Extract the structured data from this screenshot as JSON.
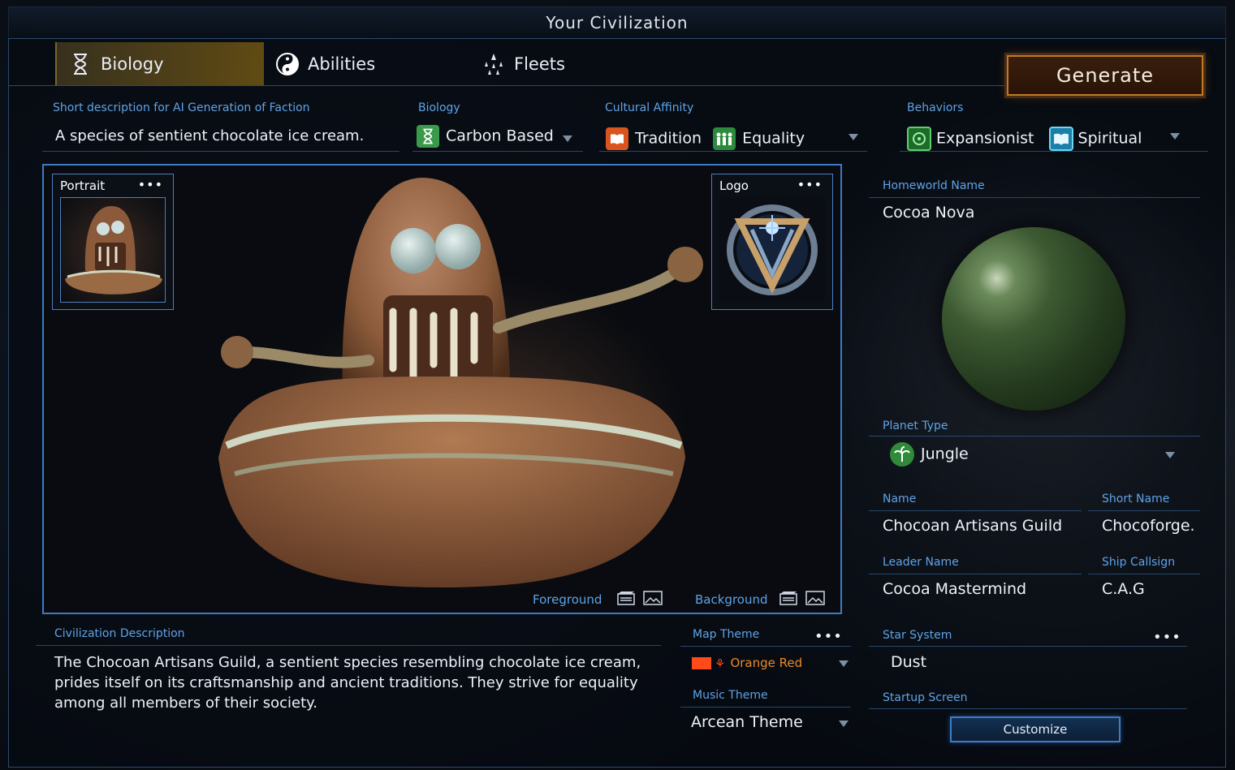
{
  "window": {
    "title": "Your Civilization"
  },
  "tabs": [
    {
      "label": "Biology",
      "icon": "dna-hourglass-icon",
      "active": true
    },
    {
      "label": "Abilities",
      "icon": "yin-yang-icon",
      "active": false
    },
    {
      "label": "Fleets",
      "icon": "fleet-ships-icon",
      "active": false
    }
  ],
  "generate_label": "Generate",
  "short_description": {
    "label": "Short description for AI Generation of Faction",
    "value": "A species of sentient chocolate ice cream."
  },
  "biology": {
    "label": "Biology",
    "value": "Carbon Based",
    "icon": "dna-hourglass-icon"
  },
  "cultural_affinity": {
    "label": "Cultural Affinity",
    "values": [
      "Tradition",
      "Equality"
    ]
  },
  "behaviors": {
    "label": "Behaviors",
    "values": [
      "Expansionist",
      "Spiritual"
    ]
  },
  "portrait": {
    "title": "Portrait",
    "menu": "•••"
  },
  "logo": {
    "title": "Logo",
    "menu": "•••"
  },
  "image_controls": {
    "foreground": "Foreground",
    "background": "Background"
  },
  "homeworld": {
    "label": "Homeworld Name",
    "value": "Cocoa Nova"
  },
  "planet_type": {
    "label": "Planet Type",
    "value": "Jungle"
  },
  "name": {
    "label": "Name",
    "value": "Chocoan Artisans Guild"
  },
  "short_name": {
    "label": "Short Name",
    "value": "Chocoforge."
  },
  "leader_name": {
    "label": "Leader Name",
    "value": "Cocoa Mastermind"
  },
  "ship_callsign": {
    "label": "Ship Callsign",
    "value": "C.A.G"
  },
  "civ_description": {
    "label": "Civilization Description",
    "value": "The Chocoan Artisans Guild, a sentient species resembling chocolate ice cream, prides itself on its craftsmanship and ancient traditions. They strive for equality among all members of their society."
  },
  "map_theme": {
    "label": "Map Theme",
    "value": "Orange Red",
    "menu": "•••"
  },
  "music_theme": {
    "label": "Music Theme",
    "value": "Arcean Theme"
  },
  "star_system": {
    "label": "Star System",
    "value": "Dust",
    "menu": "•••"
  },
  "startup_screen": {
    "label": "Startup Screen",
    "button": "Customize"
  },
  "colors": {
    "accent": "#5fa3e6",
    "generate_border": "#c07a28",
    "map_theme_swatch": "#ff4a1a"
  }
}
